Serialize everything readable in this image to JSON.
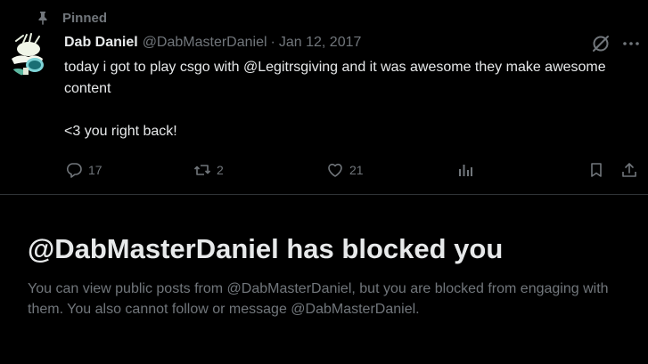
{
  "pinned": {
    "label": "Pinned",
    "icon": "pin-icon"
  },
  "post": {
    "author_name": "Dab Daniel",
    "author_handle": "@DabMasterDaniel",
    "separator": "·",
    "date": "Jan 12, 2017",
    "text_line1": "today i got to play csgo with @Legitrsgiving and it was awesome they make awesome content",
    "text_line2": "<3 you right back!",
    "replies": "17",
    "reposts": "2",
    "likes": "21"
  },
  "blocked": {
    "title": "@DabMasterDaniel has blocked you",
    "message": "You can view public posts from @DabMasterDaniel, but you are blocked from engaging with them. You also cannot follow or message @DabMasterDaniel."
  },
  "colors": {
    "background": "#000000",
    "text_primary": "#e7e9ea",
    "text_secondary": "#71767b",
    "divider": "#2f3336"
  }
}
